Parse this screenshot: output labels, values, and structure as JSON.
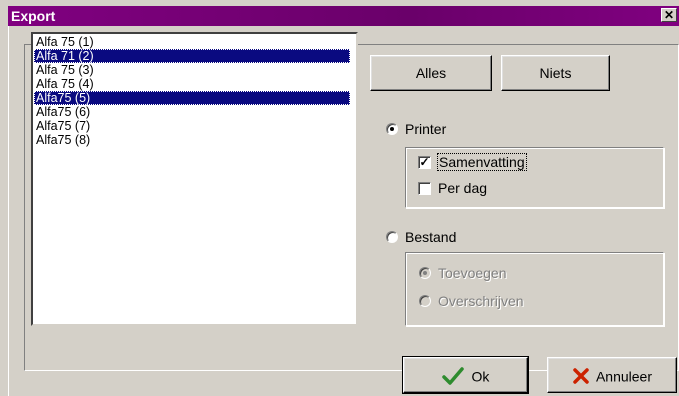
{
  "window": {
    "title": "Export",
    "close_label": "✕"
  },
  "list": {
    "items": [
      {
        "label": "Alfa 75 (1)",
        "selected": false
      },
      {
        "label": "Alfa 71 (2)",
        "selected": true
      },
      {
        "label": "Alfa 75 (3)",
        "selected": false
      },
      {
        "label": "Alfa 75 (4)",
        "selected": false
      },
      {
        "label": "Alfa75 (5)",
        "selected": true
      },
      {
        "label": "Alfa75 (6)",
        "selected": false
      },
      {
        "label": "Alfa75 (7)",
        "selected": false
      },
      {
        "label": "Alfa75 (8)",
        "selected": false
      }
    ]
  },
  "buttons": {
    "alles": "Alles",
    "niets": "Niets",
    "ok": "Ok",
    "annuleer": "Annuleer"
  },
  "output": {
    "printer": {
      "label": "Printer",
      "checked": true
    },
    "samenvatting": {
      "label": "Samenvatting",
      "checked": true
    },
    "per_dag": {
      "label": "Per dag",
      "checked": false
    },
    "bestand": {
      "label": "Bestand",
      "checked": false
    },
    "toevoegen": {
      "label": "Toevoegen",
      "checked": true,
      "enabled": false
    },
    "overschrijven": {
      "label": "Overschrijven",
      "checked": false,
      "enabled": false
    }
  },
  "icons": {
    "ok": "checkmark-icon",
    "cancel": "x-mark-icon",
    "ok_color": "#2e8b2e",
    "cancel_color": "#cc2200"
  }
}
